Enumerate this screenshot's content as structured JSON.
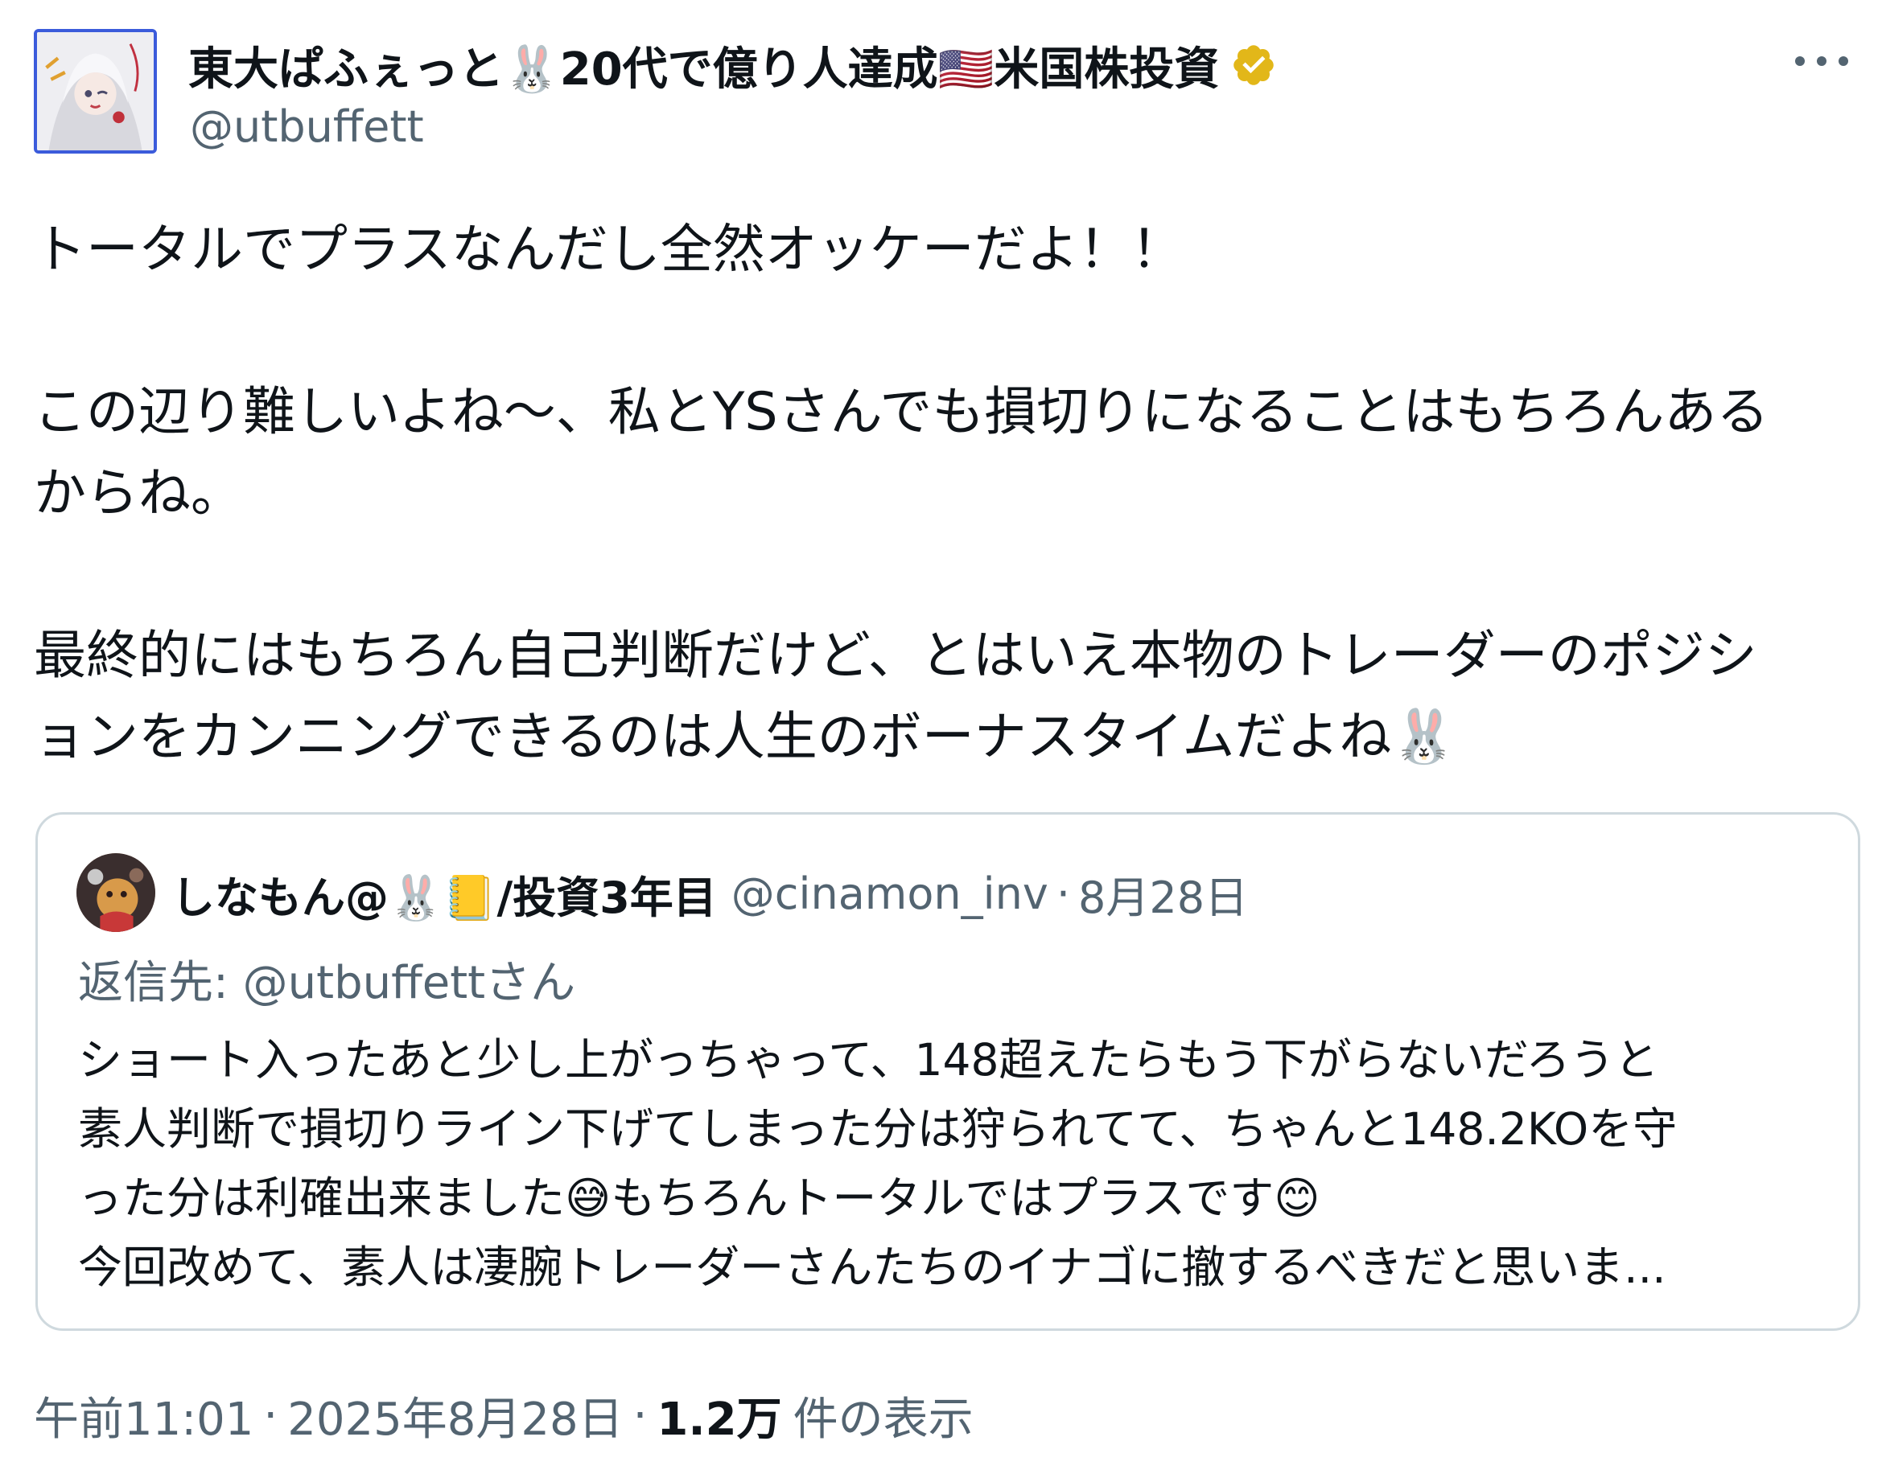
{
  "author": {
    "display_name": "東大ぱふぇっと🐰20代で億り人達成🇺🇸米国株投資",
    "handle": "@utbuffett",
    "verified_icon": "verified-badge-gold"
  },
  "more_icon": "ellipsis-icon",
  "body": "トータルでプラスなんだし全然オッケーだよ！！\n\nこの辺り難しいよね〜、私とYSさんでも損切りになることはもちろんある\nからね。\n\n最終的にはもちろん自己判断だけど、とはいえ本物のトレーダーのポジシ\nョンをカンニングできるのは人生のボーナスタイムだよね🐰",
  "quote": {
    "display_name": "しなもん@🐰📒/投資3年目",
    "handle": "@cinamon_inv",
    "separator": "·",
    "date": "8月28日",
    "reply_to": "返信先: @utbuffettさん",
    "text": "ショート入ったあと少し上がっちゃって、148超えたらもう下がらないだろうと\n素人判断で損切りライン下げてしまった分は狩られてて、ちゃんと148.2KOを守\nった分は利確出来ました😅もちろんトータルではプラスです😊\n今回改めて、素人は凄腕トレーダーさんたちのイナゴに撤するべきだと思いま..."
  },
  "footer": {
    "time": "午前11:01",
    "sep1": "·",
    "date": "2025年8月28日",
    "sep2": "·",
    "views_count": "1.2万",
    "views_label": "件の表示"
  },
  "colors": {
    "text_primary": "#0f1419",
    "text_secondary": "#536471",
    "border": "#cfd9de",
    "verified_gold": "#e2b719",
    "avatar_border": "#3b5bdb"
  }
}
